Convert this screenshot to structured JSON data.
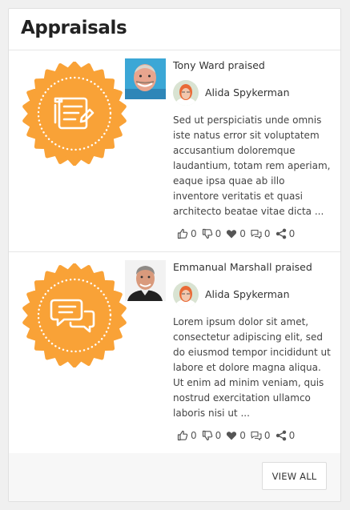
{
  "widget": {
    "title": "Appraisals",
    "view_all_label": "VIEW ALL"
  },
  "colors": {
    "badge_orange": "#f9a237",
    "icon_gray": "#555555"
  },
  "appraisals": [
    {
      "badge_icon": "notepad-icon",
      "praiser_text": "Tony Ward praised",
      "recipient": "Alida Spykerman",
      "message": "Sed ut perspiciatis unde omnis iste natus error sit voluptatem accusantium doloremque laudantium, totam rem aperiam, eaque ipsa quae ab illo inventore veritatis et quasi architecto beatae vitae dicta ...",
      "likes": "0",
      "dislikes": "0",
      "hearts": "0",
      "comments": "0",
      "shares": "0"
    },
    {
      "badge_icon": "chat-bubbles-icon",
      "praiser_text": "Emmanual Marshall praised",
      "recipient": "Alida Spykerman",
      "message": "Lorem ipsum dolor sit amet, consectetur adipiscing elit, sed do eiusmod tempor incididunt ut labore et dolore magna aliqua. Ut enim ad minim veniam, quis nostrud exercitation ullamco laboris nisi ut ...",
      "likes": "0",
      "dislikes": "0",
      "hearts": "0",
      "comments": "0",
      "shares": "0"
    }
  ]
}
